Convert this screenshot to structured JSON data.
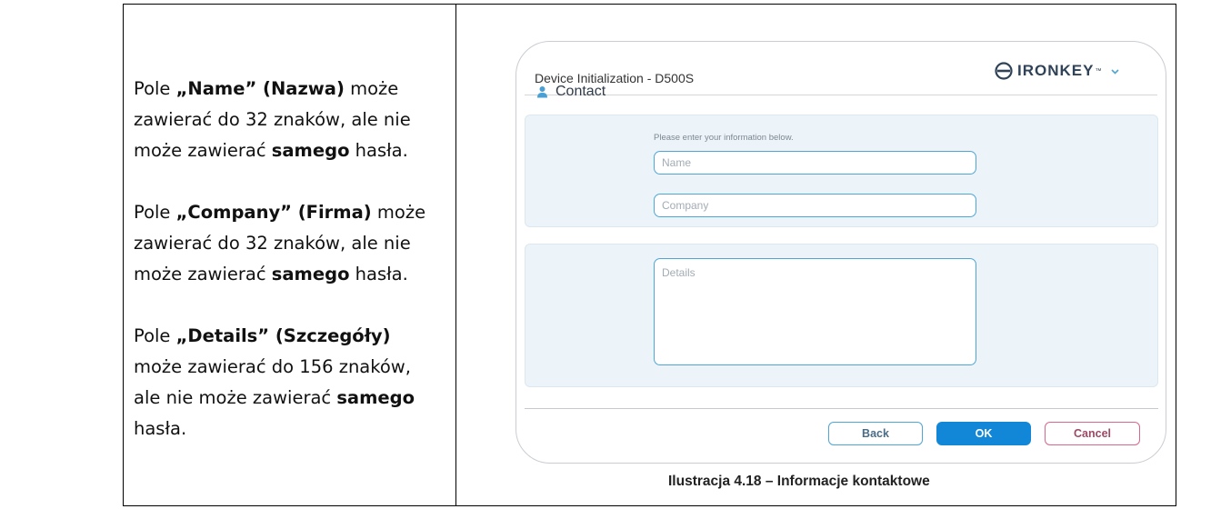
{
  "left_column": {
    "p1": {
      "pre": "Pole ",
      "field": "„Name” (Nazwa)",
      "mid": " może zawierać do 32 znaków, ale nie może zawierać ",
      "bold2": "samego",
      "post": " hasła."
    },
    "p2": {
      "pre": "Pole ",
      "field": "„Company” (Firma)",
      "mid": " może zawierać do 32 znaków, ale nie może zawierać ",
      "bold2": "samego",
      "post": " hasła."
    },
    "p3": {
      "pre": "Pole ",
      "field": "„Details” (Szczegóły)",
      "mid": " może zawierać do 156 znaków, ale nie może zawierać ",
      "bold2": "samego",
      "post": " hasła."
    }
  },
  "dialog": {
    "title": "Device Initialization - D500S",
    "brand": "IRONKEY",
    "brand_tm": "™",
    "section_icon": "person-icon",
    "section_label": "Contact",
    "instruction": "Please enter your information below.",
    "name_field": {
      "placeholder": "Name",
      "value": ""
    },
    "company_field": {
      "placeholder": "Company",
      "value": ""
    },
    "details_field": {
      "placeholder": "Details",
      "value": ""
    },
    "buttons": {
      "back": "Back",
      "ok": "OK",
      "cancel": "Cancel"
    },
    "colors": {
      "accent": "#1387d7",
      "field_border": "#4ea6d6",
      "cancel_border": "#d9668b",
      "panel_bg": "#edf4f9"
    }
  },
  "caption": "Ilustracja 4.18 – Informacje kontaktowe"
}
